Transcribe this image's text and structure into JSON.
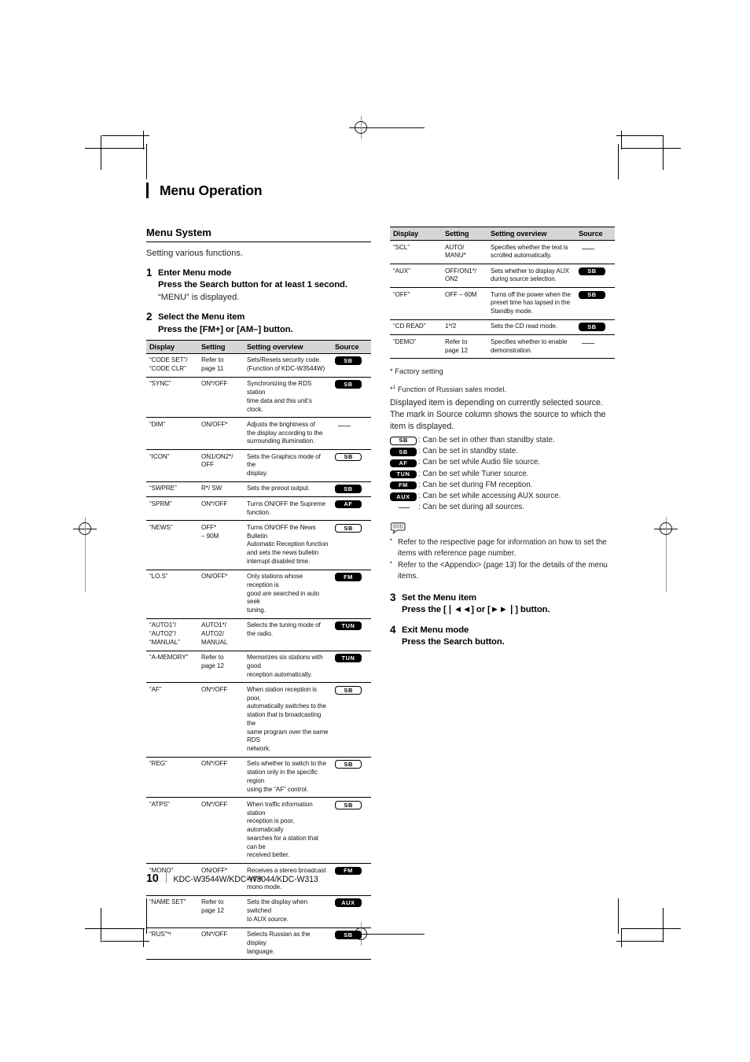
{
  "chapter_title": "Menu Operation",
  "section": {
    "heading": "Menu System",
    "lead": "Setting various functions."
  },
  "steps": [
    {
      "num": "1",
      "title": "Enter Menu mode",
      "sub": "Press the Search button for at least 1 second.",
      "note": "“MENU” is displayed."
    },
    {
      "num": "2",
      "title": "Select the Menu item",
      "sub": "Press the [FM+] or [AM–] button."
    },
    {
      "num": "3",
      "title": "Set the Menu item",
      "sub": "Press the [❘◄◄] or [►►❘] button."
    },
    {
      "num": "4",
      "title": "Exit Menu mode",
      "sub": "Press the Search button."
    }
  ],
  "table_headers": {
    "display": "Display",
    "setting": "Setting",
    "overview": "Setting overview",
    "source": "Source"
  },
  "table_left": [
    {
      "display": "“CODE SET”/\n“CODE CLR”",
      "setting": "Refer to\npage 11",
      "overview": "Sets/Resets security code.\n(Function of KDC-W3544W)",
      "source": "SB",
      "style": "filled"
    },
    {
      "display": "“SYNC”",
      "setting": "ON*/OFF",
      "overview": "Synchronizing the RDS station\ntime data and this unit’s clock.",
      "source": "SB",
      "style": "filled"
    },
    {
      "display": "“DIM”",
      "setting": "ON/OFF*",
      "overview": "Adjusts the brightness of\nthe display according to the\nsurrounding illumination.",
      "source": "—",
      "style": "dash"
    },
    {
      "display": "“ICON”",
      "setting": "ON1/ON2*/\nOFF",
      "overview": "Sets the Graphics mode of the\ndisplay.",
      "source": "SB",
      "style": "outline"
    },
    {
      "display": "“SWPRE”",
      "setting": "R*/ SW",
      "overview": "Sets the preout output.",
      "source": "SB",
      "style": "filled"
    },
    {
      "display": "“SPRM”",
      "setting": "ON*/OFF",
      "overview": "Turns ON/OFF the Supreme\nfunction.",
      "source": "AF",
      "style": "filled"
    },
    {
      "display": "“NEWS”",
      "setting": "OFF*\n– 90M",
      "overview": "Turns ON/OFF the News Bulletin\nAutomatic Reception function\nand sets the news bulletin\ninterrupt disabled time.",
      "source": "SB",
      "style": "outline"
    },
    {
      "display": "“LO.S”",
      "setting": "ON/OFF*",
      "overview": "Only stations whose reception is\ngood are searched in auto seek\ntuning.",
      "source": "FM",
      "style": "filled"
    },
    {
      "display": "“AUTO1”/\n“AUTO2”/\n“MANUAL”",
      "setting": "AUTO1*/\nAUTO2/\nMANUAL",
      "overview": "Selects the tuning mode of\nthe radio.",
      "source": "TUN",
      "style": "filled"
    },
    {
      "display": "“A-MEMORY”",
      "setting": "Refer to\npage 12",
      "overview": "Memorizes six stations with good\nreception automatically.",
      "source": "TUN",
      "style": "filled"
    },
    {
      "display": "“AF”",
      "setting": "ON*/OFF",
      "overview": "When station reception is poor,\nautomatically switches to the\nstation that is broadcasting the\nsame program over the same RDS\nnetwork.",
      "source": "SB",
      "style": "outline"
    },
    {
      "display": "“REG”",
      "setting": "ON*/OFF",
      "overview": "Sets whether to switch to the\nstation only in the specific region\nusing the “AF” control.",
      "source": "SB",
      "style": "outline"
    },
    {
      "display": "“ATPS”",
      "setting": "ON*/OFF",
      "overview": "When traffic information station\nreception is poor, automatically\nsearches for a station that can be\nreceived better.",
      "source": "SB",
      "style": "outline"
    },
    {
      "display": "“MONO”",
      "setting": "ON/OFF*",
      "overview": "Receives a stereo broadcast in the\nmono mode.",
      "source": "FM",
      "style": "filled"
    },
    {
      "display": "“NAME SET”",
      "setting": "Refer to\npage 12",
      "overview": "Sets the display when switched\nto AUX source.",
      "source": "AUX",
      "style": "filled"
    },
    {
      "display": "“RUS”*¹",
      "setting": "ON*/OFF",
      "overview": "Selects Russian as the display\nlanguage.",
      "source": "SB",
      "style": "filled"
    }
  ],
  "table_right": [
    {
      "display": "“SCL”",
      "setting": "AUTO/\nMANU*",
      "overview": "Specifies whether the text is\nscrolled automatically.",
      "source": "—",
      "style": "dash"
    },
    {
      "display": "“AUX”",
      "setting": "OFF/ON1*/\nON2",
      "overview": "Sets whether to display AUX\nduring source selection.",
      "source": "SB",
      "style": "filled"
    },
    {
      "display": "“OFF”",
      "setting": "OFF – 60M",
      "overview": "Turns off the power when the\npreset time has lapsed in the\nStandby mode.",
      "source": "SB",
      "style": "filled"
    },
    {
      "display": "“CD READ”",
      "setting": "1*/2",
      "overview": "Sets the CD read mode.",
      "source": "SB",
      "style": "filled"
    },
    {
      "display": "“DEMO”",
      "setting": "Refer to\npage 12",
      "overview": "Specifies whether to enable\ndemonstration.",
      "source": "—",
      "style": "dash"
    }
  ],
  "footnotes": {
    "factory": "* Factory setting",
    "russian_prefix": "*",
    "russian_sup": "1",
    "russian": " Function of Russian sales model.",
    "paragraph": "Displayed item is depending on currently selected source. The mark in Source column shows the source to which the item is displayed."
  },
  "legend": [
    {
      "badge": "SB",
      "style": "outline",
      "text": ": Can be set in other than standby state."
    },
    {
      "badge": "SB",
      "style": "filled",
      "text": ": Can be set in standby state."
    },
    {
      "badge": "AF",
      "style": "filled",
      "text": ": Can be set while Audio file source."
    },
    {
      "badge": "TUN",
      "style": "filled",
      "text": ": Can be set while Tuner source."
    },
    {
      "badge": "FM",
      "style": "filled",
      "text": ": Can be set during FM reception."
    },
    {
      "badge": "AUX",
      "style": "filled",
      "text": ": Can be set while accessing AUX source."
    },
    {
      "badge": "—",
      "style": "dash",
      "text": ": Can be set during all sources."
    }
  ],
  "tips": [
    "Refer to the respective page for information on how to set the items with reference page number.",
    "Refer to the <Appendix> (page 13) for the details of the menu items."
  ],
  "footer": {
    "page_number": "10",
    "models": "KDC-W3544W/KDC-W3044/KDC-W313"
  }
}
